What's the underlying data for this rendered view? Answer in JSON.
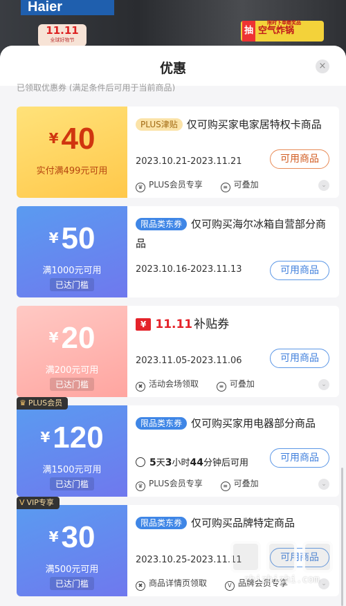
{
  "background": {
    "brand": "Haier",
    "festival_badge": "11.11",
    "festival_sub": "全球好物节",
    "promo_draw": "抽",
    "promo_text": "空气炸锅",
    "promo_sub": "限时下单赠奖品"
  },
  "sheet": {
    "title": "优惠",
    "close_icon": "×",
    "hint": "已领取优惠券    (满足条件后可用于当前商品)"
  },
  "coupons": [
    {
      "symbol": "¥",
      "amount": "40",
      "condition": "实付满499元可用",
      "tag": "PLUS津贴",
      "title": "仅可购买家电家居特权卡商品",
      "date": "2023.10.21-2023.11.21",
      "button": "可用商品",
      "features": [
        "PLUS会员专享",
        "可叠加"
      ]
    },
    {
      "symbol": "¥",
      "amount": "50",
      "condition": "满1000元可用",
      "reached": "已达门槛",
      "tag": "限品类东券",
      "title": "仅可购买海尔冰箱自营部分商品",
      "date": "2023.10.16-2023.11.13",
      "button": "可用商品"
    },
    {
      "symbol": "¥",
      "amount": "20",
      "condition": "满200元可用",
      "reached": "已达门槛",
      "stamp": "¥",
      "tag_brand": "11.11",
      "title": "补贴券",
      "date": "2023.11.05-2023.11.06",
      "button": "可用商品",
      "features": [
        "活动会场领取",
        "可叠加"
      ]
    },
    {
      "badge": "PLUS会员",
      "symbol": "¥",
      "amount": "120",
      "condition": "满1500元可用",
      "reached": "已达门槛",
      "tag": "限品类东券",
      "title": "仅可购买家用电器部分商品",
      "countdown": {
        "days": "5",
        "d_unit": "天",
        "hours": "3",
        "h_unit": "小时",
        "mins": "44",
        "m_unit": "分钟后可用"
      },
      "button": "可用商品",
      "features": [
        "PLUS会员专享",
        "可叠加"
      ]
    },
    {
      "badge": "VIP专享",
      "symbol": "¥",
      "amount": "30",
      "condition": "满500元可用",
      "reached": "已达门槛",
      "tag": "限品类东券",
      "title": "仅可购买品牌特定商品",
      "date": "2023.10.25-2023.11.11",
      "button": "可用商品",
      "features": [
        "商品详情页领取",
        "品牌会员专享"
      ]
    }
  ],
  "watermark": {
    "site": "zhizhizhi.com"
  }
}
